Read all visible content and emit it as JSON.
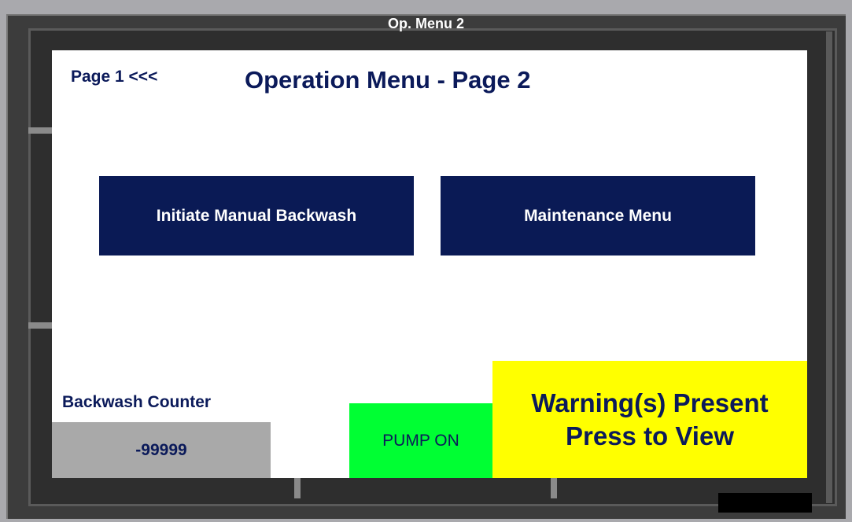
{
  "window": {
    "title": "Op. Menu 2"
  },
  "header": {
    "page_link": "Page 1 <<<",
    "title": "Operation Menu - Page 2"
  },
  "buttons": {
    "manual_backwash": "Initiate Manual Backwash",
    "maintenance_menu": "Maintenance Menu"
  },
  "backwash_counter": {
    "label": "Backwash Counter",
    "value": "-99999"
  },
  "pump_status": {
    "label": "PUMP ON",
    "color": "#00ff33"
  },
  "warning": {
    "line1": "Warning(s) Present",
    "line2": "Press to View",
    "color": "#ffff00"
  },
  "colors": {
    "navy": "#0a1a55",
    "screen_bg": "#ffffff",
    "frame": "#3c3c3c"
  }
}
